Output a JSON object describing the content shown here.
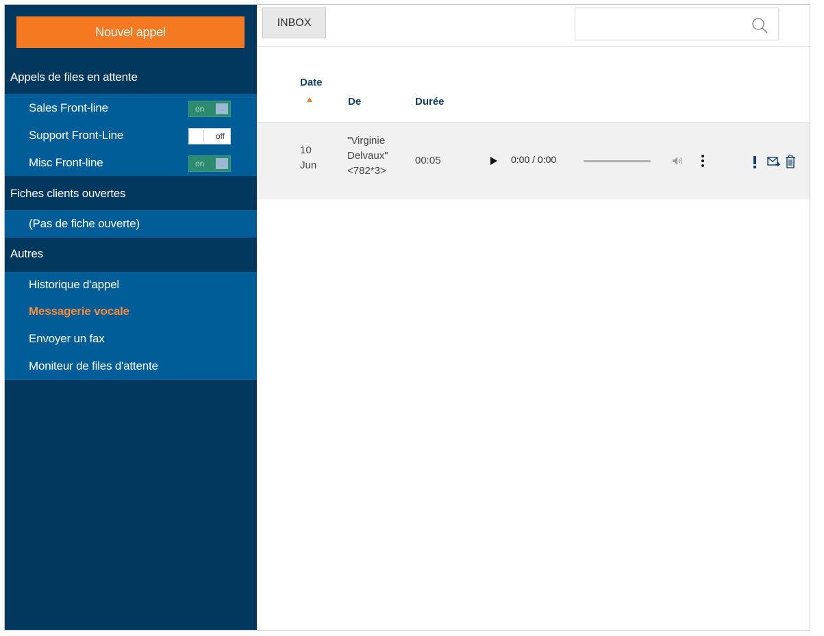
{
  "sidebar": {
    "new_call_label": "Nouvel appel",
    "queues_title": "Appels de files en attente",
    "queues": [
      {
        "label": "Sales Front-line",
        "toggle": "on"
      },
      {
        "label": "Support Front-Line",
        "toggle": "off"
      },
      {
        "label": "Misc Front-line",
        "toggle": "on"
      }
    ],
    "files_title": "Fiches clients ouvertes",
    "files_empty": "(Pas de fiche ouverte)",
    "others_title": "Autres",
    "others": [
      {
        "label": "Historique d'appel"
      },
      {
        "label": "Messagerie vocale",
        "active": true
      },
      {
        "label": "Envoyer un fax"
      },
      {
        "label": "Moniteur de files d'attente"
      }
    ]
  },
  "toolbar": {
    "inbox_label": "INBOX",
    "search_placeholder": ""
  },
  "table": {
    "headers": {
      "date": "Date",
      "from": "De",
      "duration": "Durée"
    },
    "rows": [
      {
        "date_day": "10",
        "date_month": "Jun",
        "from_line1": "\"Virginie",
        "from_line2": "Delvaux\"",
        "from_line3": "<782*3>",
        "duration": "00:05",
        "player_time": "0:00 / 0:00"
      }
    ]
  },
  "colors": {
    "sidebar_bg": "#02375e",
    "sidebar_block": "#005d97",
    "accent": "#f47920",
    "active_item": "#f68b3b",
    "toggle_on": "#2c8a6e"
  },
  "icons": [
    "search-icon",
    "sort-asc-icon",
    "play-icon",
    "volume-icon",
    "more-vertical-icon",
    "urgent-icon",
    "forward-mail-icon",
    "trash-icon"
  ]
}
